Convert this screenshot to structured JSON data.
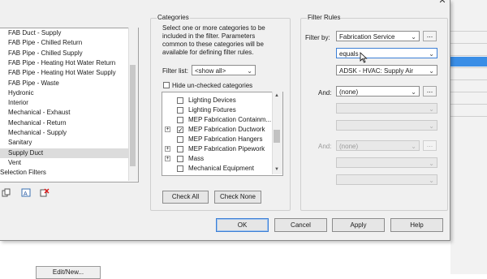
{
  "window": {
    "close_glyph": "✕"
  },
  "filter_list": {
    "items": [
      "FAB Duct - Supply",
      "FAB Pipe - Chilled Return",
      "FAB Pipe - Chilled Supply",
      "FAB Pipe - Heating Hot Water Return",
      "FAB Pipe - Heating Hot Water Supply",
      "FAB Pipe - Waste",
      "Hydronic",
      "Interior",
      "Mechanical - Exhaust",
      "Mechanical - Return",
      "Mechanical - Supply",
      "Sanitary",
      "Supply Duct",
      "Vent",
      "Selection Filters"
    ],
    "selected_index": 12
  },
  "categories": {
    "group_title": "Categories",
    "description": [
      "Select one or more categories to be",
      "included in the filter.  Parameters",
      "common to these categories will be",
      "available for defining filter rules."
    ],
    "filter_list_label": "Filter list:",
    "filter_list_value": "<show all>",
    "hide_unchecked_label": "Hide un-checked categories",
    "tree": [
      {
        "label": "Lighting Devices",
        "expander": "",
        "checked": false
      },
      {
        "label": "Lighting Fixtures",
        "expander": "",
        "checked": false
      },
      {
        "label": "MEP Fabrication Containm...",
        "expander": "",
        "checked": false
      },
      {
        "label": "MEP Fabrication Ductwork",
        "expander": "+",
        "checked": true
      },
      {
        "label": "MEP Fabrication Hangers",
        "expander": "",
        "checked": false
      },
      {
        "label": "MEP Fabrication Pipework",
        "expander": "+",
        "checked": false
      },
      {
        "label": "Mass",
        "expander": "+",
        "checked": false
      },
      {
        "label": "Mechanical Equipment",
        "expander": "",
        "checked": false
      }
    ],
    "check_all": "Check All",
    "check_none": "Check None"
  },
  "filter_rules": {
    "group_title": "Filter Rules",
    "filter_by_label": "Filter by:",
    "filter_by_value": "Fabrication Service",
    "operator_value": "equals",
    "value_value": "ADSK - HVAC: Supply Air",
    "and1_label": "And:",
    "and1_value": "(none)",
    "and2_label": "And:",
    "and2_value": "(none)",
    "dots_label": "..."
  },
  "footer": {
    "ok": "OK",
    "cancel": "Cancel",
    "apply": "Apply",
    "help": "Help"
  },
  "background": {
    "edit_new": "Edit/New..."
  }
}
